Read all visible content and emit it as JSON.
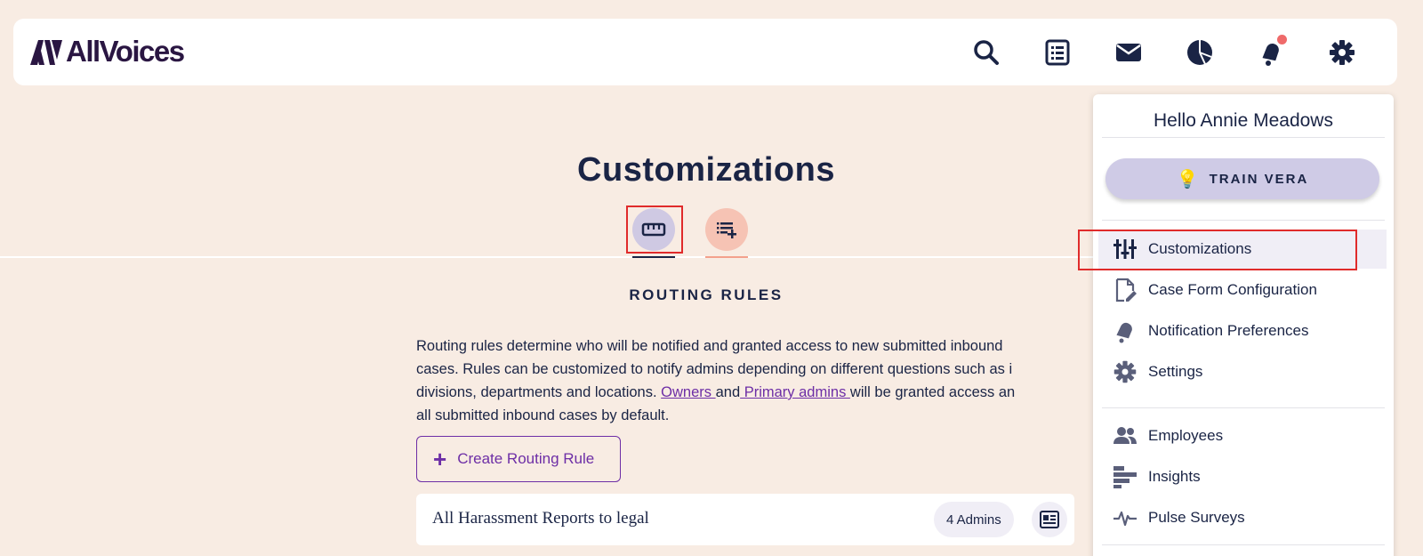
{
  "header": {
    "logo_text": "AllVoices",
    "icons": [
      "search-icon",
      "reports-list-icon",
      "mail-icon",
      "pie-chart-icon",
      "bell-icon",
      "gear-icon"
    ]
  },
  "page": {
    "title": "Customizations",
    "tabs": [
      {
        "icon": "ruler-icon",
        "active": true
      },
      {
        "icon": "list-add-icon",
        "active": false
      }
    ],
    "section_title": "ROUTING RULES",
    "description": {
      "line1": "Routing rules determine who will be notified and granted access to new submitted inbound",
      "line2": "cases. Rules can be customized to notify admins depending on different questions such as i",
      "line3_before": "divisions, departments and locations. ",
      "owners_link": "Owners ",
      "and_text": "and",
      "primary_admins_link": " Primary admins ",
      "line3_after": "will be granted access an",
      "line4": "all submitted inbound cases by default."
    },
    "create_button": "Create Routing Rule",
    "rules": [
      {
        "name": "All Harassment Reports to legal",
        "admins": "4 Admins"
      }
    ]
  },
  "menu": {
    "greeting": "Hello Annie Meadows",
    "train_button": "TRAIN VERA",
    "items": [
      {
        "label": "Customizations",
        "icon": "sliders-icon",
        "active": true
      },
      {
        "label": "Case Form Configuration",
        "icon": "file-edit-icon"
      },
      {
        "label": "Notification Preferences",
        "icon": "bell-icon"
      },
      {
        "label": "Settings",
        "icon": "gear-icon"
      },
      {
        "label": "Employees",
        "icon": "people-icon"
      },
      {
        "label": "Insights",
        "icon": "bar-chart-icon"
      },
      {
        "label": "Pulse Surveys",
        "icon": "pulse-icon"
      }
    ]
  },
  "colors": {
    "background": "#f8ece3",
    "navy": "#1a2445",
    "purple": "#6d2ea6",
    "highlight": "#e02b2b"
  }
}
